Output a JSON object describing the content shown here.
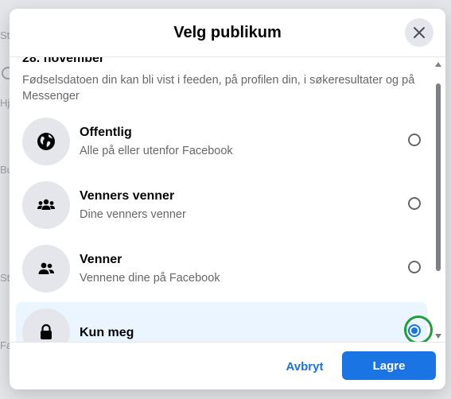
{
  "background": {
    "fragments": [
      "St",
      "Hj",
      "Bu",
      "St",
      "Fa"
    ]
  },
  "dialog": {
    "title": "Velg publikum",
    "close_icon": "close-icon",
    "date_text": "28. november",
    "description": "Fødselsdatoen din kan bli vist i feeden, på profilen din, i søkeresultater og på Messenger",
    "options": [
      {
        "label": "Offentlig",
        "sublabel": "Alle på eller utenfor Facebook",
        "icon": "globe-icon",
        "selected": false
      },
      {
        "label": "Venners venner",
        "sublabel": "Dine venners venner",
        "icon": "friends-of-friends-icon",
        "selected": false
      },
      {
        "label": "Venner",
        "sublabel": "Vennene dine på Facebook",
        "icon": "friends-icon",
        "selected": false
      },
      {
        "label": "Kun meg",
        "sublabel": "",
        "icon": "lock-icon",
        "selected": true
      }
    ],
    "cancel_label": "Avbryt",
    "save_label": "Lagre"
  },
  "colors": {
    "accent": "#1b74e4",
    "selected_bg": "#ebf5ff",
    "focus_ring": "#1e9f3a"
  }
}
